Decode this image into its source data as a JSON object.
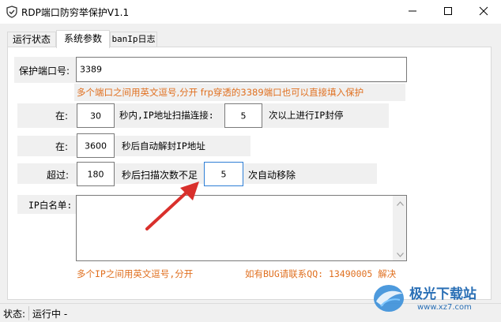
{
  "window": {
    "title": "RDP端口防穷举保护V1.1",
    "app_icon": "shield-check-icon",
    "controls": {
      "minimize": "minimize-icon",
      "maximize": "maximize-icon",
      "close": "close-icon"
    }
  },
  "tabs": [
    {
      "label": "运行状态",
      "active": false
    },
    {
      "label": "系统参数",
      "active": true
    },
    {
      "label": "banIp日志",
      "active": false
    }
  ],
  "settings": {
    "port_label": "保护端口号:",
    "port_value": "3389",
    "port_hint": "多个端口之间用英文逗号,分开  frp穿透的3389端口也可以直接填入保护",
    "scan_prefix": "在:",
    "scan_seconds": "30",
    "scan_middle": "秒内,IP地址扫描连接:",
    "scan_count": "5",
    "scan_suffix": "次以上进行IP封停",
    "unban_prefix": "在:",
    "unban_seconds": "3600",
    "unban_suffix": "秒后自动解封IP地址",
    "remove_prefix": "超过:",
    "remove_seconds": "180",
    "remove_middle": "秒后扫描次数不足",
    "remove_count": "5",
    "remove_suffix": "次自动移除",
    "whitelist_label": "IP白名单:",
    "whitelist_value": "",
    "whitelist_hint": "多个IP之间用英文逗号,分开",
    "bug_contact": "如有BUG请联系QQ: 13490005 解决"
  },
  "statusbar": {
    "label": "状态:",
    "value": "运行中 -"
  },
  "watermark": {
    "text": "极光下载站",
    "url": "www.xz7.com"
  },
  "colors": {
    "hint": "#e07020",
    "arrow": "#d9302c",
    "focus": "#2f7fd6",
    "group_bg": "#f0f0f0"
  }
}
